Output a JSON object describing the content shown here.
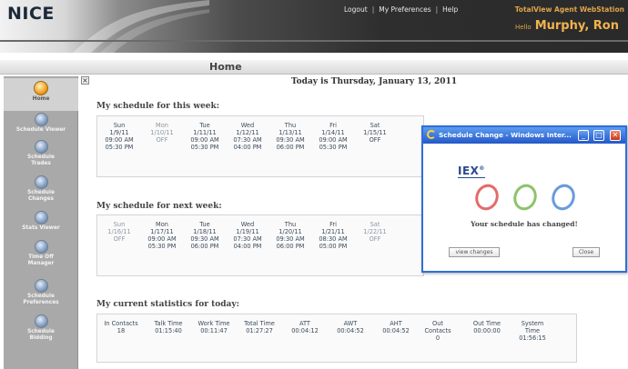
{
  "header": {
    "logo": "NICE",
    "nav": [
      "Logout",
      "My Preferences",
      "Help"
    ],
    "app_title": "TotalView Agent WebStation",
    "hello": "Hello",
    "user_name": "Murphy, Ron"
  },
  "page": {
    "title": "Home",
    "today": "Today is Thursday, January 13, 2011"
  },
  "sidebar": {
    "items": [
      {
        "label": "Home",
        "icon": "home-icon"
      },
      {
        "label": "Schedule Viewer",
        "icon": "calendar-icon"
      },
      {
        "label": "Schedule Trades",
        "icon": "trade-icon"
      },
      {
        "label": "Schedule Changes",
        "icon": "changes-icon"
      },
      {
        "label": "Stats Viewer",
        "icon": "stats-icon"
      },
      {
        "label": "Time Off Manager",
        "icon": "timeoff-icon"
      },
      {
        "label": "Schedule Preferences",
        "icon": "preferences-icon"
      },
      {
        "label": "Schedule Bidding",
        "icon": "bidding-icon"
      }
    ],
    "collapse": "×"
  },
  "this_week": {
    "title": "My schedule for this week:",
    "days": [
      {
        "day": "Sun",
        "date": "1/9/11",
        "start": "09:00 AM",
        "end": "05:30 PM"
      },
      {
        "day": "Mon",
        "date": "1/10/11",
        "start": "OFF",
        "end": ""
      },
      {
        "day": "Tue",
        "date": "1/11/11",
        "start": "09:00 AM",
        "end": "05:30 PM"
      },
      {
        "day": "Wed",
        "date": "1/12/11",
        "start": "07:30 AM",
        "end": "04:00 PM"
      },
      {
        "day": "Thu",
        "date": "1/13/11",
        "start": "09:30 AM",
        "end": "06:00 PM"
      },
      {
        "day": "Fri",
        "date": "1/14/11",
        "start": "09:00 AM",
        "end": "05:30 PM"
      },
      {
        "day": "Sat",
        "date": "1/15/11",
        "start": "OFF",
        "end": ""
      }
    ]
  },
  "next_week": {
    "title": "My schedule for next week:",
    "days": [
      {
        "day": "Sun",
        "date": "1/16/11",
        "start": "OFF",
        "end": ""
      },
      {
        "day": "Mon",
        "date": "1/17/11",
        "start": "09:00 AM",
        "end": "05:30 PM"
      },
      {
        "day": "Tue",
        "date": "1/18/11",
        "start": "09:30 AM",
        "end": "06:00 PM"
      },
      {
        "day": "Wed",
        "date": "1/19/11",
        "start": "07:30 AM",
        "end": "04:00 PM"
      },
      {
        "day": "Thu",
        "date": "1/20/11",
        "start": "09:30 AM",
        "end": "06:00 PM"
      },
      {
        "day": "Fri",
        "date": "1/21/11",
        "start": "08:30 AM",
        "end": "05:00 PM"
      },
      {
        "day": "Sat",
        "date": "1/22/11",
        "start": "OFF",
        "end": ""
      }
    ]
  },
  "stats": {
    "title": "My current statistics for today:",
    "items": [
      {
        "label": "In Contacts",
        "value": "18"
      },
      {
        "label": "Talk Time",
        "value": "01:15:40"
      },
      {
        "label": "Work Time",
        "value": "00:11:47"
      },
      {
        "label": "Total Time",
        "value": "01:27:27"
      },
      {
        "label": "ATT",
        "value": "00:04:12"
      },
      {
        "label": "AWT",
        "value": "00:04:52"
      },
      {
        "label": "AHT",
        "value": "00:04:52"
      },
      {
        "label": "Out Contacts",
        "value": "0"
      },
      {
        "label": "Out Time",
        "value": "00:00:00"
      },
      {
        "label": "System Time",
        "value": "01:56:15"
      }
    ]
  },
  "popup": {
    "title": "Schedule Change - Windows Inter...",
    "logo": "IEX",
    "logo_mark": "®",
    "message": "Your schedule has changed!",
    "view_changes": "view changes",
    "close": "Close",
    "min": "_",
    "max": "□",
    "x": "✕"
  },
  "colors": {
    "accent": "#f0b34e",
    "popup_border": "#2f6fd8",
    "sidebar": "#a9a9a9"
  }
}
